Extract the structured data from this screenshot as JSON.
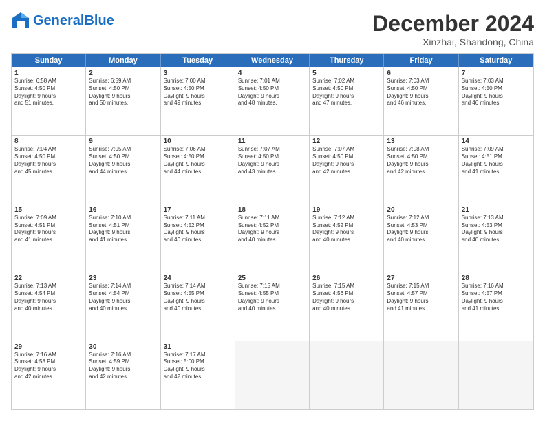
{
  "header": {
    "logo_line1": "General",
    "logo_line2": "Blue",
    "month": "December 2024",
    "location": "Xinzhai, Shandong, China"
  },
  "weekdays": [
    "Sunday",
    "Monday",
    "Tuesday",
    "Wednesday",
    "Thursday",
    "Friday",
    "Saturday"
  ],
  "weeks": [
    [
      {
        "day": "1",
        "info": "Sunrise: 6:58 AM\nSunset: 4:50 PM\nDaylight: 9 hours\nand 51 minutes."
      },
      {
        "day": "2",
        "info": "Sunrise: 6:59 AM\nSunset: 4:50 PM\nDaylight: 9 hours\nand 50 minutes."
      },
      {
        "day": "3",
        "info": "Sunrise: 7:00 AM\nSunset: 4:50 PM\nDaylight: 9 hours\nand 49 minutes."
      },
      {
        "day": "4",
        "info": "Sunrise: 7:01 AM\nSunset: 4:50 PM\nDaylight: 9 hours\nand 48 minutes."
      },
      {
        "day": "5",
        "info": "Sunrise: 7:02 AM\nSunset: 4:50 PM\nDaylight: 9 hours\nand 47 minutes."
      },
      {
        "day": "6",
        "info": "Sunrise: 7:03 AM\nSunset: 4:50 PM\nDaylight: 9 hours\nand 46 minutes."
      },
      {
        "day": "7",
        "info": "Sunrise: 7:03 AM\nSunset: 4:50 PM\nDaylight: 9 hours\nand 46 minutes."
      }
    ],
    [
      {
        "day": "8",
        "info": "Sunrise: 7:04 AM\nSunset: 4:50 PM\nDaylight: 9 hours\nand 45 minutes."
      },
      {
        "day": "9",
        "info": "Sunrise: 7:05 AM\nSunset: 4:50 PM\nDaylight: 9 hours\nand 44 minutes."
      },
      {
        "day": "10",
        "info": "Sunrise: 7:06 AM\nSunset: 4:50 PM\nDaylight: 9 hours\nand 44 minutes."
      },
      {
        "day": "11",
        "info": "Sunrise: 7:07 AM\nSunset: 4:50 PM\nDaylight: 9 hours\nand 43 minutes."
      },
      {
        "day": "12",
        "info": "Sunrise: 7:07 AM\nSunset: 4:50 PM\nDaylight: 9 hours\nand 42 minutes."
      },
      {
        "day": "13",
        "info": "Sunrise: 7:08 AM\nSunset: 4:50 PM\nDaylight: 9 hours\nand 42 minutes."
      },
      {
        "day": "14",
        "info": "Sunrise: 7:09 AM\nSunset: 4:51 PM\nDaylight: 9 hours\nand 41 minutes."
      }
    ],
    [
      {
        "day": "15",
        "info": "Sunrise: 7:09 AM\nSunset: 4:51 PM\nDaylight: 9 hours\nand 41 minutes."
      },
      {
        "day": "16",
        "info": "Sunrise: 7:10 AM\nSunset: 4:51 PM\nDaylight: 9 hours\nand 41 minutes."
      },
      {
        "day": "17",
        "info": "Sunrise: 7:11 AM\nSunset: 4:52 PM\nDaylight: 9 hours\nand 40 minutes."
      },
      {
        "day": "18",
        "info": "Sunrise: 7:11 AM\nSunset: 4:52 PM\nDaylight: 9 hours\nand 40 minutes."
      },
      {
        "day": "19",
        "info": "Sunrise: 7:12 AM\nSunset: 4:52 PM\nDaylight: 9 hours\nand 40 minutes."
      },
      {
        "day": "20",
        "info": "Sunrise: 7:12 AM\nSunset: 4:53 PM\nDaylight: 9 hours\nand 40 minutes."
      },
      {
        "day": "21",
        "info": "Sunrise: 7:13 AM\nSunset: 4:53 PM\nDaylight: 9 hours\nand 40 minutes."
      }
    ],
    [
      {
        "day": "22",
        "info": "Sunrise: 7:13 AM\nSunset: 4:54 PM\nDaylight: 9 hours\nand 40 minutes."
      },
      {
        "day": "23",
        "info": "Sunrise: 7:14 AM\nSunset: 4:54 PM\nDaylight: 9 hours\nand 40 minutes."
      },
      {
        "day": "24",
        "info": "Sunrise: 7:14 AM\nSunset: 4:55 PM\nDaylight: 9 hours\nand 40 minutes."
      },
      {
        "day": "25",
        "info": "Sunrise: 7:15 AM\nSunset: 4:55 PM\nDaylight: 9 hours\nand 40 minutes."
      },
      {
        "day": "26",
        "info": "Sunrise: 7:15 AM\nSunset: 4:56 PM\nDaylight: 9 hours\nand 40 minutes."
      },
      {
        "day": "27",
        "info": "Sunrise: 7:15 AM\nSunset: 4:57 PM\nDaylight: 9 hours\nand 41 minutes."
      },
      {
        "day": "28",
        "info": "Sunrise: 7:16 AM\nSunset: 4:57 PM\nDaylight: 9 hours\nand 41 minutes."
      }
    ],
    [
      {
        "day": "29",
        "info": "Sunrise: 7:16 AM\nSunset: 4:58 PM\nDaylight: 9 hours\nand 42 minutes."
      },
      {
        "day": "30",
        "info": "Sunrise: 7:16 AM\nSunset: 4:59 PM\nDaylight: 9 hours\nand 42 minutes."
      },
      {
        "day": "31",
        "info": "Sunrise: 7:17 AM\nSunset: 5:00 PM\nDaylight: 9 hours\nand 42 minutes."
      },
      null,
      null,
      null,
      null
    ]
  ]
}
